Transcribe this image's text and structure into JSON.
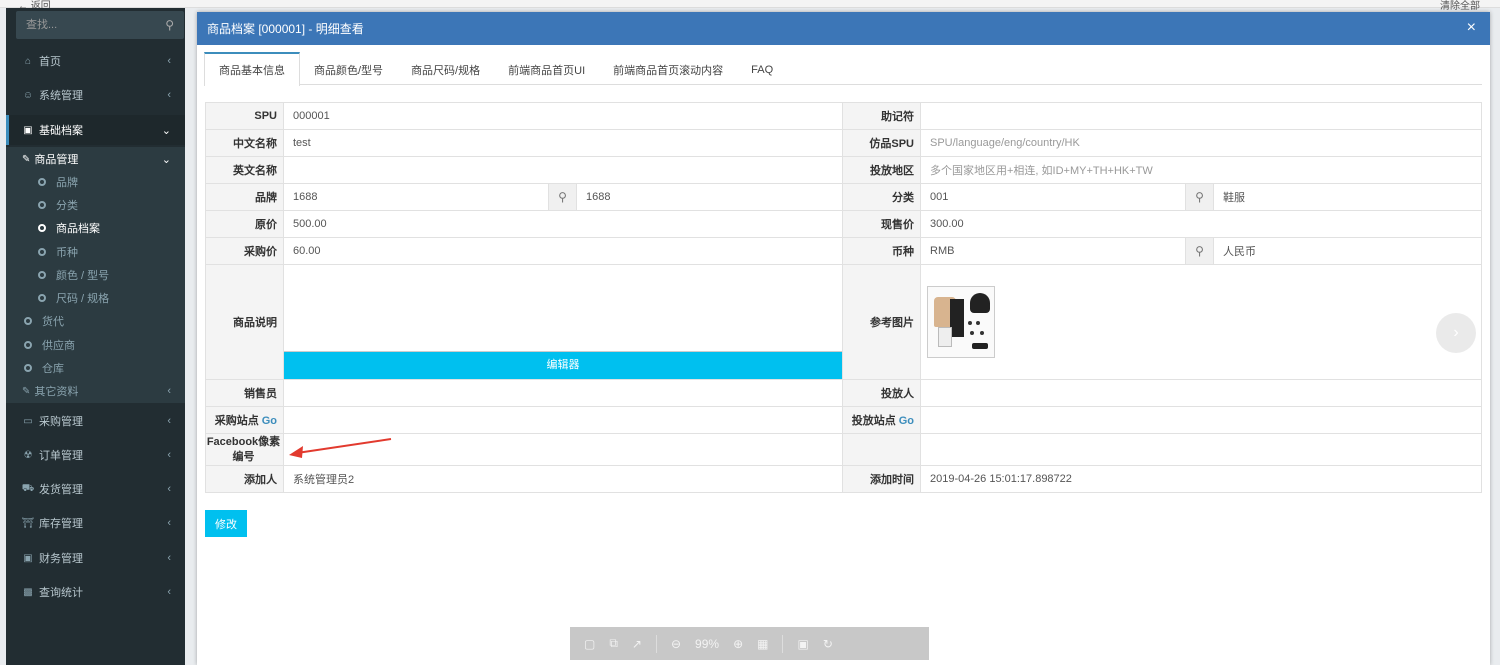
{
  "top": {
    "back_label": "← 返回",
    "right_label": "清除全部"
  },
  "sidebar": {
    "search_placeholder": "查找...",
    "items": [
      {
        "label": "首页",
        "icon": "home-icon"
      },
      {
        "label": "系统管理",
        "icon": "user-circle-icon"
      },
      {
        "label": "基础档案",
        "icon": "database-icon"
      }
    ],
    "sub": {
      "product_mgmt": "商品管理",
      "children": [
        "品牌",
        "分类",
        "商品档案",
        "币种",
        "颜色 / 型号",
        "尺码 / 规格"
      ],
      "others": [
        "货代",
        "供应商",
        "仓库"
      ],
      "other_data": "其它资料"
    },
    "more": [
      {
        "label": "采购管理",
        "icon": "credit-card-icon"
      },
      {
        "label": "订单管理",
        "icon": "cart-icon"
      },
      {
        "label": "发货管理",
        "icon": "truck-icon"
      },
      {
        "label": "库存管理",
        "icon": "bank-icon"
      },
      {
        "label": "财务管理",
        "icon": "money-icon"
      },
      {
        "label": "查询统计",
        "icon": "bar-chart-icon"
      }
    ]
  },
  "modal": {
    "title": "商品档案 [000001] - 明细查看",
    "close": "×",
    "tabs": [
      "商品基本信息",
      "商品颜色/型号",
      "商品尺码/规格",
      "前端商品首页UI",
      "前端商品首页滚动内容",
      "FAQ"
    ],
    "form": {
      "spu_label": "SPU",
      "spu": "000001",
      "mnemonic_label": "助记符",
      "mnemonic": "",
      "cn_name_label": "中文名称",
      "cn_name": "test",
      "fake_spu_label": "仿品SPU",
      "fake_spu_ph": "SPU/language/eng/country/HK",
      "en_name_label": "英文名称",
      "en_name": "",
      "region_label": "投放地区",
      "region_ph": "多个国家地区用+相连, 如ID+MY+TH+HK+TW",
      "brand_label": "品牌",
      "brand_code": "1688",
      "brand_name": "1688",
      "category_label": "分类",
      "category_code": "001",
      "category_name": "鞋服",
      "orig_price_label": "原价",
      "orig_price": "500.00",
      "cur_price_label": "现售价",
      "cur_price": "300.00",
      "purchase_price_label": "采购价",
      "purchase_price": "60.00",
      "currency_label": "币种",
      "currency_code": "RMB",
      "currency_name": "人民币",
      "desc_label": "商品说明",
      "editor_btn": "编辑器",
      "ref_img_label": "参考图片",
      "seller_label": "销售员",
      "seller": "",
      "investor_label": "投放人",
      "investor": "",
      "buy_site_label": "采购站点",
      "go": "Go",
      "put_site_label": "投放站点",
      "fb_label": "Facebook像素编号",
      "adder_label": "添加人",
      "adder": "系统管理员2",
      "add_time_label": "添加时间",
      "add_time": "2019-04-26 15:01:17.898722"
    },
    "submit": "修改",
    "next": "›"
  },
  "viewer": {
    "zoom": "99%"
  }
}
